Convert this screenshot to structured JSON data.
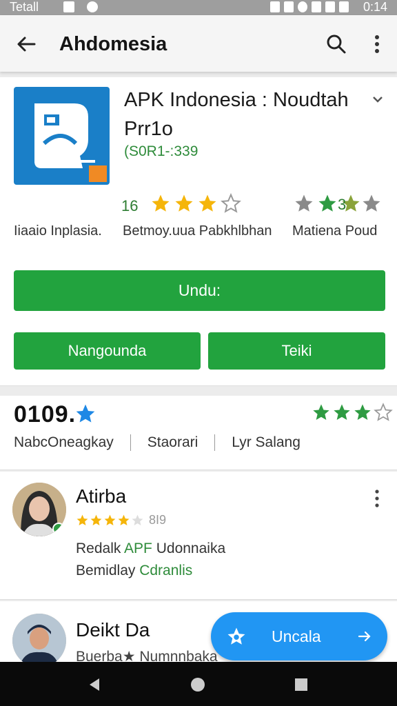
{
  "status_bar": {
    "carrier": "Tetall",
    "time": "0:14"
  },
  "app_bar": {
    "title": "Ahdomesia"
  },
  "app": {
    "title_line1": "APK Indonesia : Noudtah",
    "title_line2": "Prr1o",
    "subtitle": "(S0R1-:339",
    "stat_num": "16",
    "stars_a": 3.5,
    "stars_b_num": "3",
    "meta": [
      "Iiaaio Inplasia.",
      "Betmoy.uua Pabkhlbhan",
      "Matiena Poud"
    ]
  },
  "buttons": {
    "main": "Undu:",
    "secondary_left": "Nangounda",
    "secondary_right": "Teiki"
  },
  "rating": {
    "value": "0109.",
    "tabs": [
      "NabcOneagkay",
      "Staorari",
      "Lyr Salang"
    ],
    "green_stars": 3.5
  },
  "reviews": [
    {
      "name": "Atirba",
      "stars": 4,
      "count": "8I9",
      "line1_a": "Redalk ",
      "line1_b": "APF",
      "line1_c": " Udonnaika",
      "line2_a": "Bemidlay ",
      "line2_b": "Cdranlis"
    },
    {
      "name": "Deikt Da",
      "line": "Buerba★ Numnnbaka"
    }
  ],
  "fab": {
    "label": "Uncala"
  },
  "colors": {
    "accent_green": "#22a33e",
    "fab_blue": "#2196f3",
    "star_gold": "#f5b50a"
  }
}
